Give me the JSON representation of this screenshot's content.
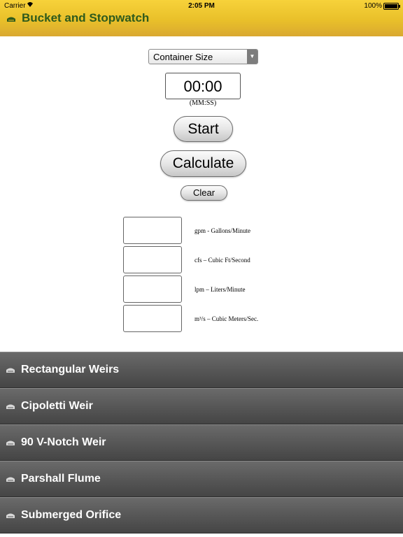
{
  "status_bar": {
    "carrier": "Carrier",
    "time": "2:05 PM",
    "battery": "100%"
  },
  "header": {
    "title": "Bucket and Stopwatch"
  },
  "container_select": {
    "selected": "Container Size"
  },
  "timer": {
    "value": "00:00",
    "hint": "(MM:SS)"
  },
  "buttons": {
    "start": "Start",
    "calculate": "Calculate",
    "clear": "Clear"
  },
  "results": [
    {
      "unit": "gpm - Gallons/Minute",
      "value": ""
    },
    {
      "unit": "cfs – Cubic Ft/Second",
      "value": ""
    },
    {
      "unit": "lpm – Liters/Minute",
      "value": ""
    },
    {
      "unit": "m³/s – Cubic Meters/Sec.",
      "value": ""
    }
  ],
  "menu": [
    {
      "label": "Rectangular Weirs"
    },
    {
      "label": "Cipoletti Weir"
    },
    {
      "label": "90 V-Notch Weir"
    },
    {
      "label": "Parshall Flume"
    },
    {
      "label": "Submerged Orifice"
    }
  ],
  "colors": {
    "header": "#e9c02a",
    "header_text": "#2e5a1c",
    "menu_bg": "#575757"
  }
}
